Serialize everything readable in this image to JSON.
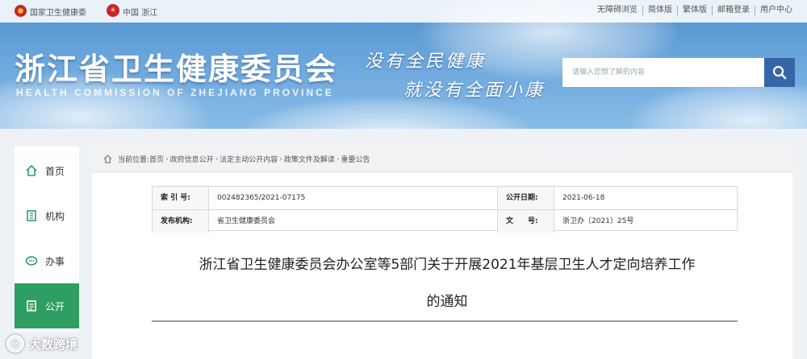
{
  "topbar": {
    "site_left": "国家卫生健康委",
    "site_china": "中国 浙江",
    "links": [
      "无障碍浏览",
      "简体版",
      "繁体版",
      "邮箱登录",
      "用户中心"
    ]
  },
  "header": {
    "title": "浙江省卫生健康委员会",
    "subtitle": "HEALTH COMMISSION OF ZHEJIANG PROVINCE",
    "slogan_line1": "没有全民健康",
    "slogan_line2": "就没有全面小康"
  },
  "search": {
    "placeholder": "请输入您想了解的内容"
  },
  "sidebar": {
    "items": [
      {
        "label": "首页",
        "icon": "home-icon"
      },
      {
        "label": "机构",
        "icon": "building-icon"
      },
      {
        "label": "办事",
        "icon": "chat-icon"
      },
      {
        "label": "公开",
        "icon": "document-icon",
        "active": true
      }
    ]
  },
  "breadcrumb": {
    "prefix": "当前位置:",
    "items": [
      "首页",
      "政府信息公开",
      "法定主动公开内容",
      "政策文件及解读",
      "重要公告"
    ]
  },
  "meta": {
    "index_label": "索 引 号:",
    "index_value": "002482365/2021-07175",
    "date_label": "公开日期:",
    "date_value": "2021-06-18",
    "issuer_label": "发布机构:",
    "issuer_value": "省卫生健康委员会",
    "docno_label": "文　　号:",
    "docno_value": "浙卫办〔2021〕25号"
  },
  "document": {
    "title_line1": "浙江省卫生健康委员会办公室等5部门关于开展2021年基层卫生人才定向培养工作",
    "title_line2": "的通知"
  },
  "watermark": {
    "text": "大数跨境"
  },
  "colors": {
    "banner": "#5b9bd5",
    "active_nav": "#2f9e62",
    "search_button": "#3566a8"
  }
}
